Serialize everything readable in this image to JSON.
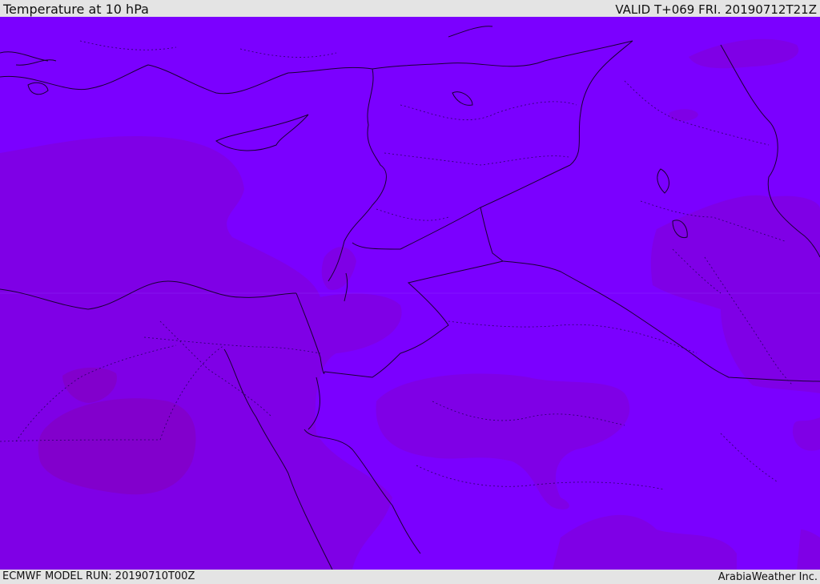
{
  "header": {
    "title": "Temperature at 10 hPa",
    "valid": "VALID T+069 FRI. 20190712T21Z"
  },
  "footer": {
    "model_run": "ECMWF MODEL RUN: 20190710T00Z",
    "credit": "ArabiaWeather Inc."
  },
  "map": {
    "field": "temperature",
    "level": "10 hPa",
    "colors": {
      "background": "#7b00ff",
      "warmer_shade_1": "#7f00e6",
      "warmer_shade_2": "#8200cc",
      "coastline": "#1a0033",
      "border": "#1a0033"
    }
  }
}
